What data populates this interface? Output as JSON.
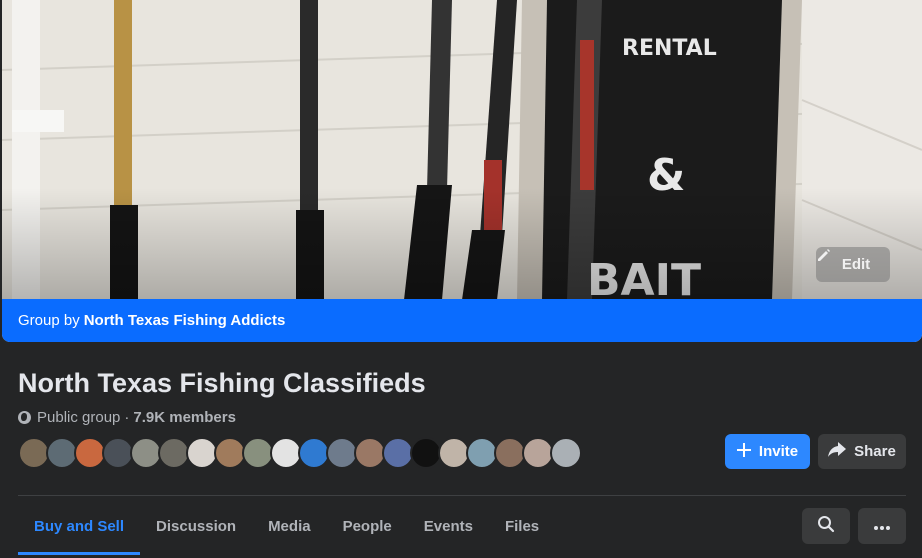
{
  "cover": {
    "edit_label": "Edit",
    "group_by_prefix": "Group by",
    "group_by_name": "North Texas Fishing Addicts"
  },
  "group": {
    "title": "North Texas Fishing Classifieds",
    "privacy": "Public group",
    "separator": "·",
    "members": "7.9K members"
  },
  "members_preview": {
    "avatar_colors": [
      "#7a6a55",
      "#5d6b74",
      "#c9683f",
      "#4a5058",
      "#8d8f86",
      "#6c6a62",
      "#d9d4cf",
      "#a07b5c",
      "#88907e",
      "#e3e3e3",
      "#2f7ad1",
      "#6e7b8c",
      "#9a7865",
      "#5a6fa6",
      "#111111",
      "#c0b4a8",
      "#7f9fb0",
      "#8a6f5e",
      "#b8a49a",
      "#aab0b5"
    ]
  },
  "actions": {
    "invite_label": "Invite",
    "share_label": "Share"
  },
  "tabs": [
    {
      "label": "Buy and Sell",
      "active": true
    },
    {
      "label": "Discussion"
    },
    {
      "label": "Media"
    },
    {
      "label": "People"
    },
    {
      "label": "Events"
    },
    {
      "label": "Files"
    }
  ],
  "colors": {
    "accent": "#2d88ff",
    "banner": "#0a6cff",
    "background": "#242526"
  }
}
